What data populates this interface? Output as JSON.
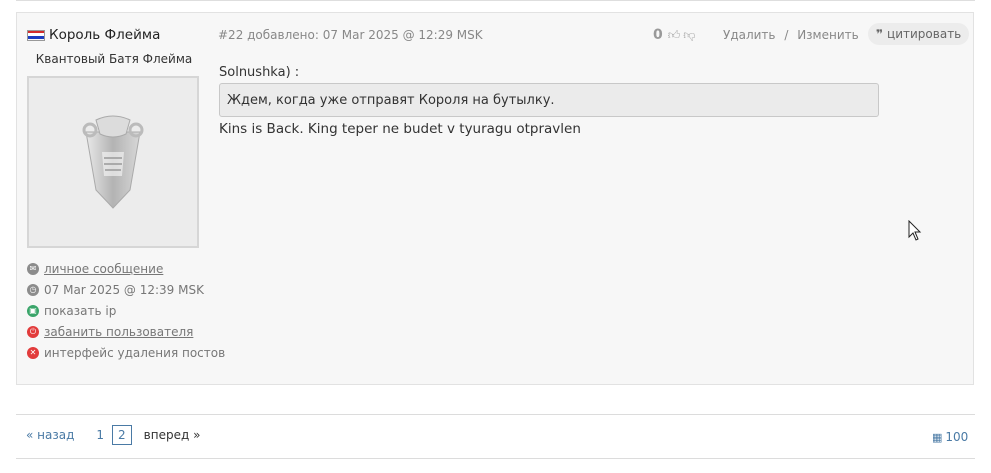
{
  "post": {
    "author": {
      "name": "Король Флейма",
      "title": "Квантовый Батя Флейма",
      "flag_colors": [
        "#ffffff",
        "#1a3cc0",
        "#d22b2b"
      ]
    },
    "actions": [
      {
        "icon": "envelope-icon",
        "label": "личное сообщение",
        "link": true,
        "color": "#8c8c8c"
      },
      {
        "icon": "clock-icon",
        "label": "07 Mar 2025 @ 12:39 MSK",
        "link": false,
        "color": "#8c8c8c"
      },
      {
        "icon": "ip-icon",
        "label": "показать ip",
        "link": false,
        "color": "#3aa56a"
      },
      {
        "icon": "power-icon",
        "label": "забанить пользователя",
        "link": true,
        "color": "#e23b3b"
      },
      {
        "icon": "delete-icon",
        "label": "интерфейс удаления постов",
        "link": false,
        "color": "#e23b3b"
      }
    ],
    "meta": "#22 добавлено: 07 Mar 2025 @ 12:29 MSK",
    "rating": "0",
    "delete_label": "Удалить",
    "separator": "/",
    "edit_label": "Изменить",
    "quote_label": "цитировать",
    "quote_author": "Solnushka) :",
    "quote_text": "Ждем, когда уже отправят Короля на бутылку.",
    "text": "Kins is Back. King teper ne budet v tyuragu otpravlen"
  },
  "pager": {
    "prev": "« назад",
    "pages": [
      "1",
      "2"
    ],
    "current": "2",
    "next": "вперед »",
    "per_page": "100"
  }
}
